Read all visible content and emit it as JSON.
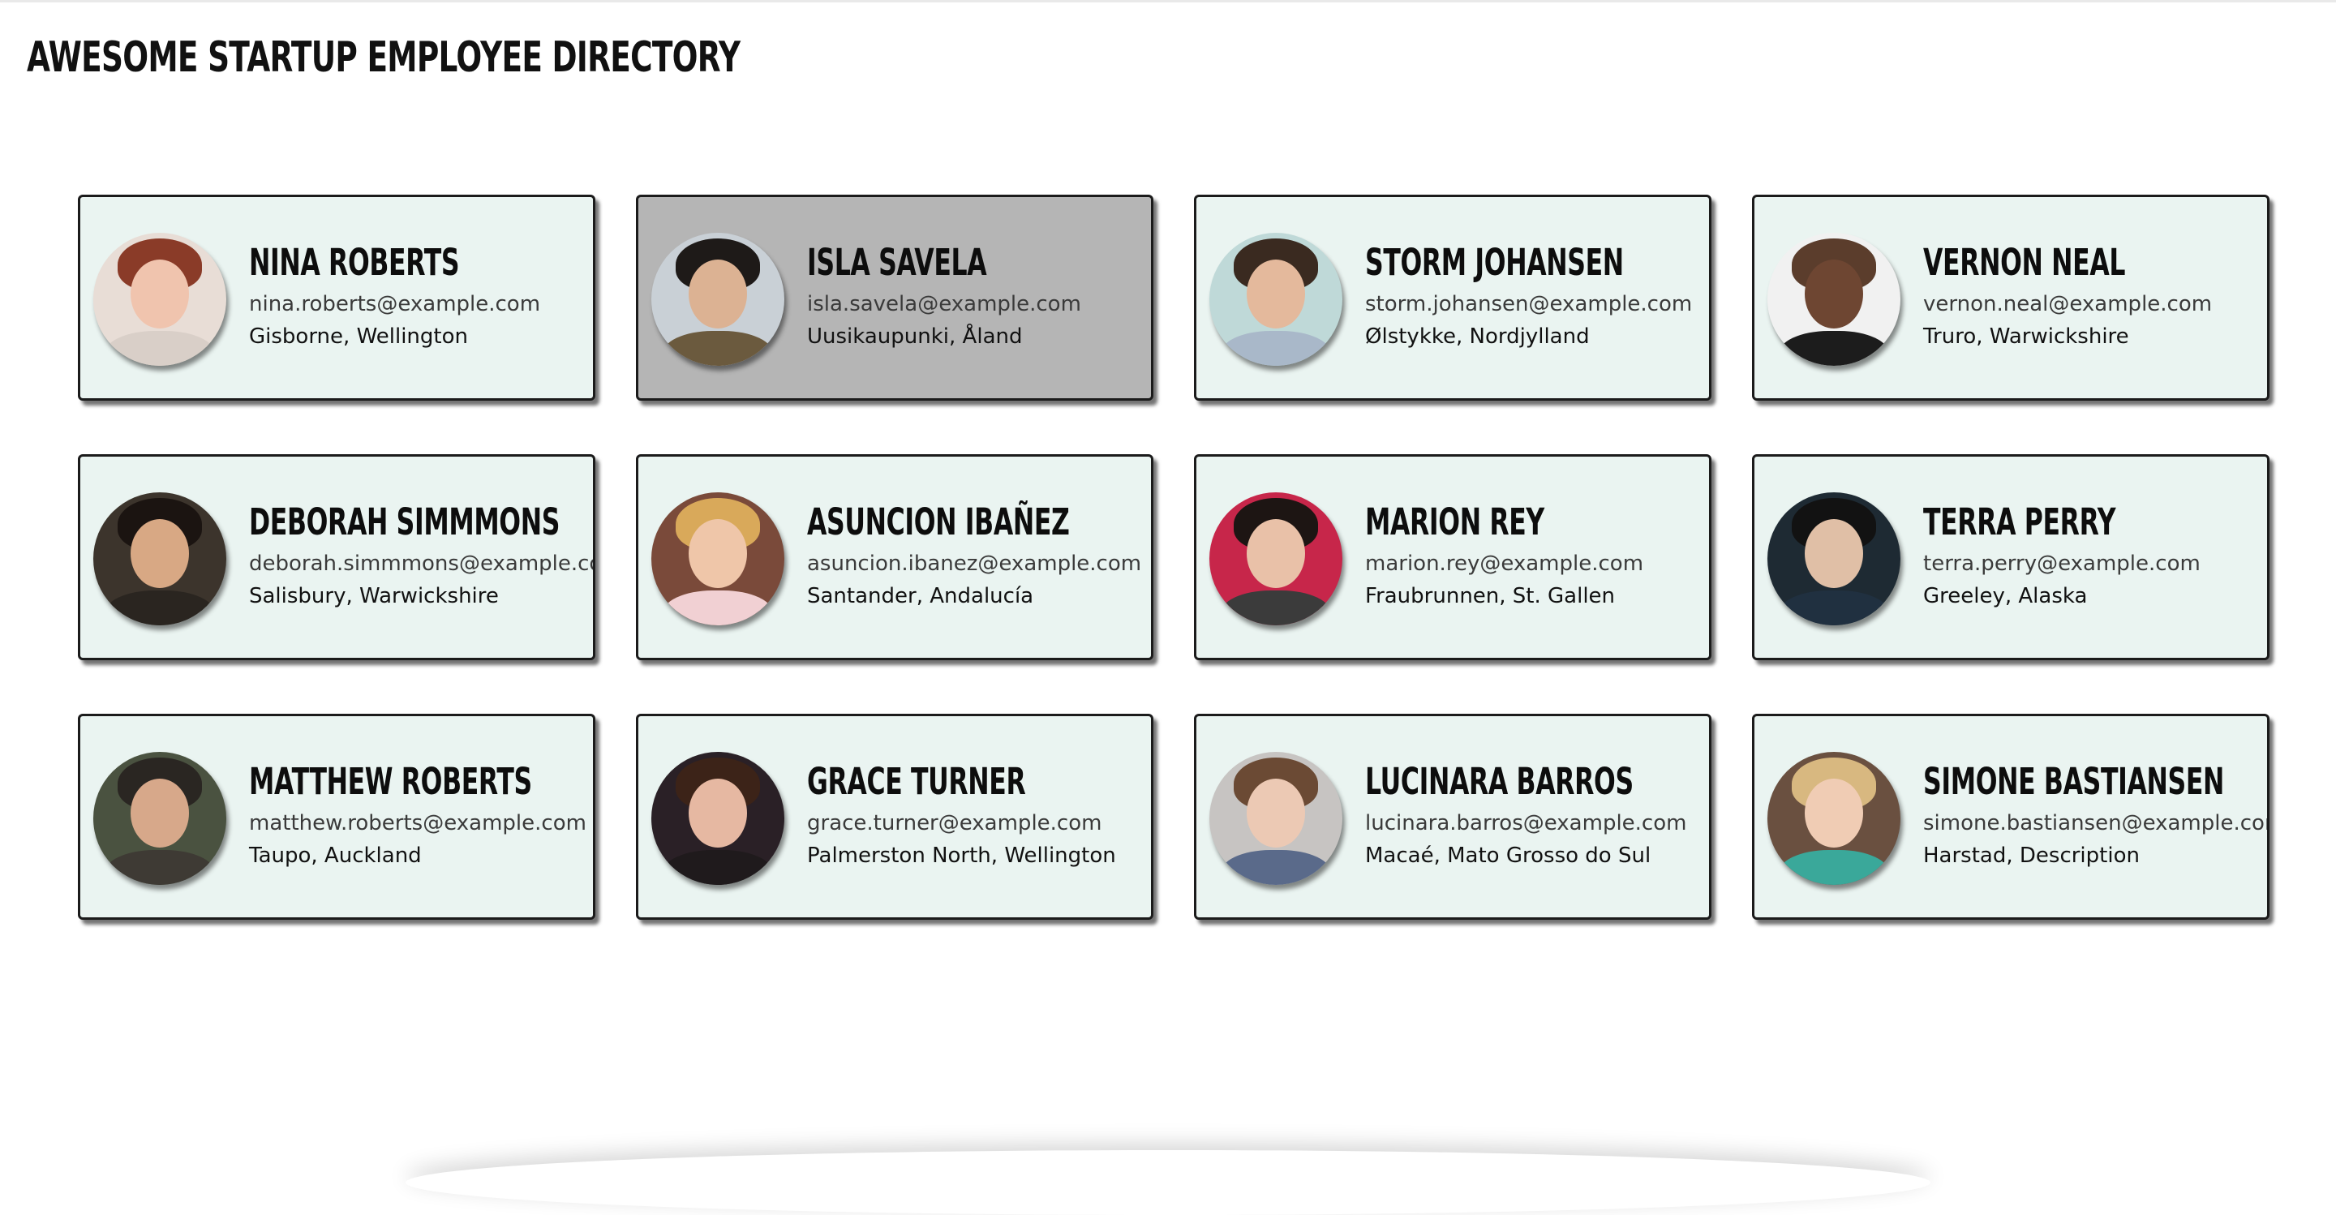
{
  "header": {
    "title": "AWESOME STARTUP EMPLOYEE DIRECTORY"
  },
  "employees": [
    {
      "name": "NINA ROBERTS",
      "email": "nina.roberts@example.com",
      "location": "Gisborne, Wellington",
      "active": false,
      "avatar": {
        "bg": "#e8ddd6",
        "hair": "#8a3b28",
        "skin": "#f0c4ae",
        "shirt": "#d9cfc8"
      }
    },
    {
      "name": "ISLA SAVELA",
      "email": "isla.savela@example.com",
      "location": "Uusikaupunki, Åland",
      "active": true,
      "avatar": {
        "bg": "#c9d0d6",
        "hair": "#1e1a18",
        "skin": "#dcb293",
        "shirt": "#6b5a3e"
      }
    },
    {
      "name": "STORM JOHANSEN",
      "email": "storm.johansen@example.com",
      "location": "Ølstykke, Nordjylland",
      "active": false,
      "avatar": {
        "bg": "#bfd9d8",
        "hair": "#3a2a20",
        "skin": "#e4b99c",
        "shirt": "#a9b8c9"
      }
    },
    {
      "name": "VERNON NEAL",
      "email": "vernon.neal@example.com",
      "location": "Truro, Warwickshire",
      "active": false,
      "avatar": {
        "bg": "#f1f1f1",
        "hair": "#5b3d2c",
        "skin": "#6e4632",
        "shirt": "#1c1c1c"
      }
    },
    {
      "name": "DEBORAH SIMMMONS",
      "email": "deborah.simmmons@example.com",
      "location": "Salisbury, Warwickshire",
      "active": false,
      "avatar": {
        "bg": "#3c342c",
        "hair": "#1b1411",
        "skin": "#d8a884",
        "shirt": "#2a2520"
      }
    },
    {
      "name": "ASUNCION IBAÑEZ",
      "email": "asuncion.ibanez@example.com",
      "location": "Santander, Andalucía",
      "active": false,
      "avatar": {
        "bg": "#7a4a3a",
        "hair": "#d9a95a",
        "skin": "#efc6a9",
        "shirt": "#f1d0d3"
      }
    },
    {
      "name": "MARION REY",
      "email": "marion.rey@example.com",
      "location": "Fraubrunnen, St. Gallen",
      "active": false,
      "avatar": {
        "bg": "#c7264a",
        "hair": "#1d1513",
        "skin": "#e9c1a8",
        "shirt": "#3b3b3b"
      }
    },
    {
      "name": "TERRA PERRY",
      "email": "terra.perry@example.com",
      "location": "Greeley, Alaska",
      "active": false,
      "avatar": {
        "bg": "#1e2a33",
        "hair": "#121212",
        "skin": "#e0bfa6",
        "shirt": "#203040"
      }
    },
    {
      "name": "MATTHEW ROBERTS",
      "email": "matthew.roberts@example.com",
      "location": "Taupo, Auckland",
      "active": false,
      "avatar": {
        "bg": "#4a5240",
        "hair": "#2a2622",
        "skin": "#d7a88a",
        "shirt": "#3e3a34"
      }
    },
    {
      "name": "GRACE TURNER",
      "email": "grace.turner@example.com",
      "location": "Palmerston North, Wellington",
      "active": false,
      "avatar": {
        "bg": "#2a2026",
        "hair": "#3c2318",
        "skin": "#e6b8a2",
        "shirt": "#1f1a1c"
      }
    },
    {
      "name": "LUCINARA BARROS",
      "email": "lucinara.barros@example.com",
      "location": "Macaé, Mato Grosso do Sul",
      "active": false,
      "avatar": {
        "bg": "#c7c4c2",
        "hair": "#6b4a34",
        "skin": "#ecc9b4",
        "shirt": "#5a6a8a"
      }
    },
    {
      "name": "SIMONE BASTIANSEN",
      "email": "simone.bastiansen@example.com",
      "location": "Harstad, Description",
      "active": false,
      "avatar": {
        "bg": "#6a5040",
        "hair": "#d8b880",
        "skin": "#f0ccb4",
        "shirt": "#3aa89a"
      }
    }
  ]
}
